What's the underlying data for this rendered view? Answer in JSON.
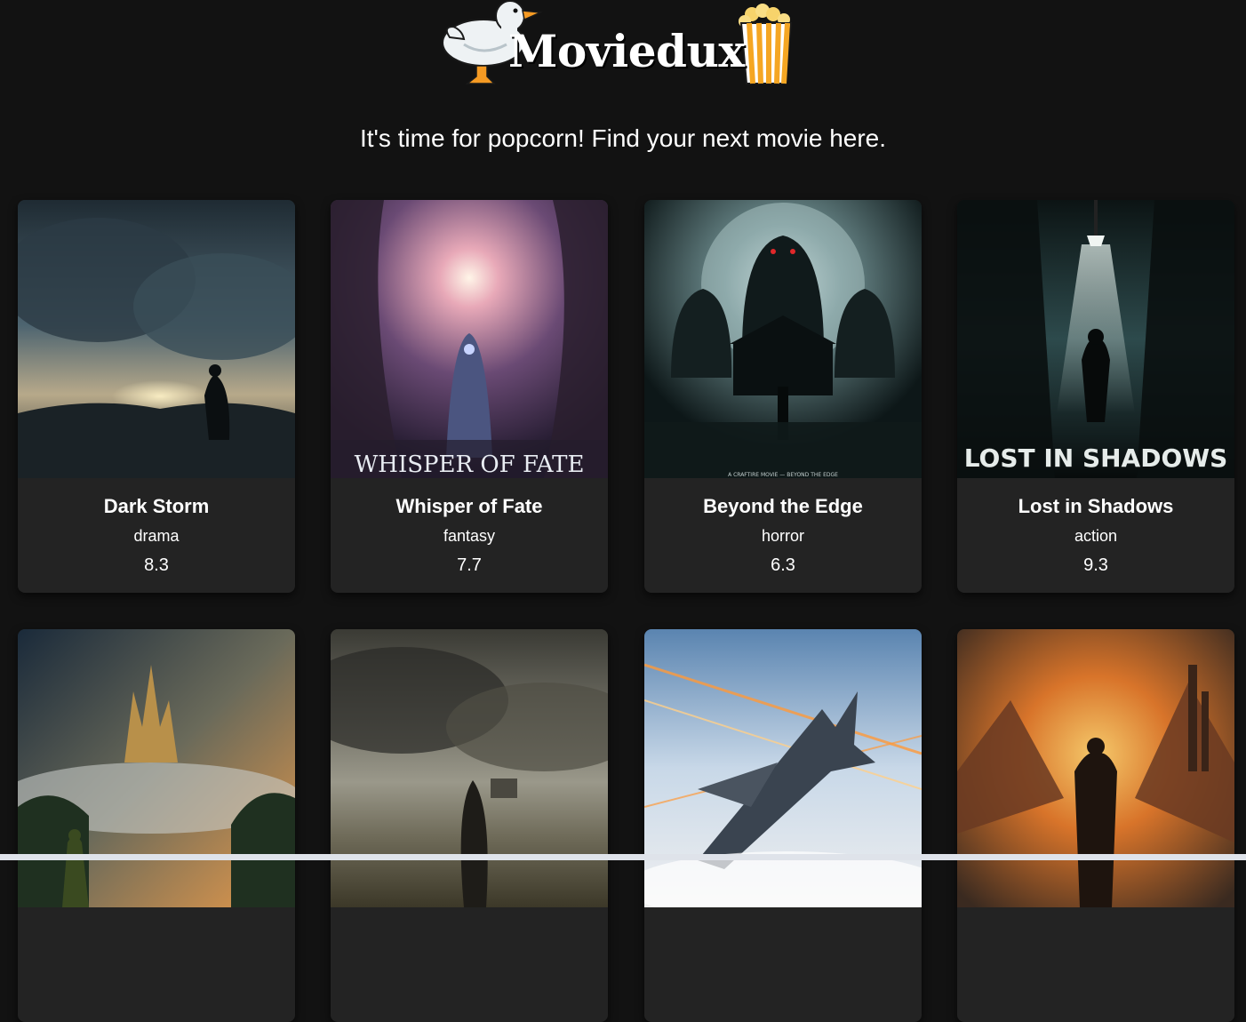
{
  "header": {
    "logo_text": "Moviedux",
    "tagline": "It's time for popcorn! Find your next movie here."
  },
  "movies": [
    {
      "title": "Dark Storm",
      "genre": "drama",
      "rating": "8.3",
      "poster_text": ""
    },
    {
      "title": "Whisper of Fate",
      "genre": "fantasy",
      "rating": "7.7",
      "poster_text": "WHISPER OF FATE"
    },
    {
      "title": "Beyond the Edge",
      "genre": "horror",
      "rating": "6.3",
      "poster_text": "A CRAFTIRE MOVIE — BEYOND THE EDGE"
    },
    {
      "title": "Lost in Shadows",
      "genre": "action",
      "rating": "9.3",
      "poster_text": "LOST IN SHADOWS"
    },
    {
      "title": "",
      "genre": "",
      "rating": "",
      "poster_text": ""
    },
    {
      "title": "",
      "genre": "",
      "rating": "",
      "poster_text": ""
    },
    {
      "title": "",
      "genre": "",
      "rating": "",
      "poster_text": ""
    },
    {
      "title": "",
      "genre": "",
      "rating": "",
      "poster_text": ""
    }
  ],
  "colors": {
    "background": "#121212",
    "card": "#232323",
    "popcorn": "#f5a623"
  },
  "icons": [
    "duck-icon",
    "popcorn-icon"
  ]
}
